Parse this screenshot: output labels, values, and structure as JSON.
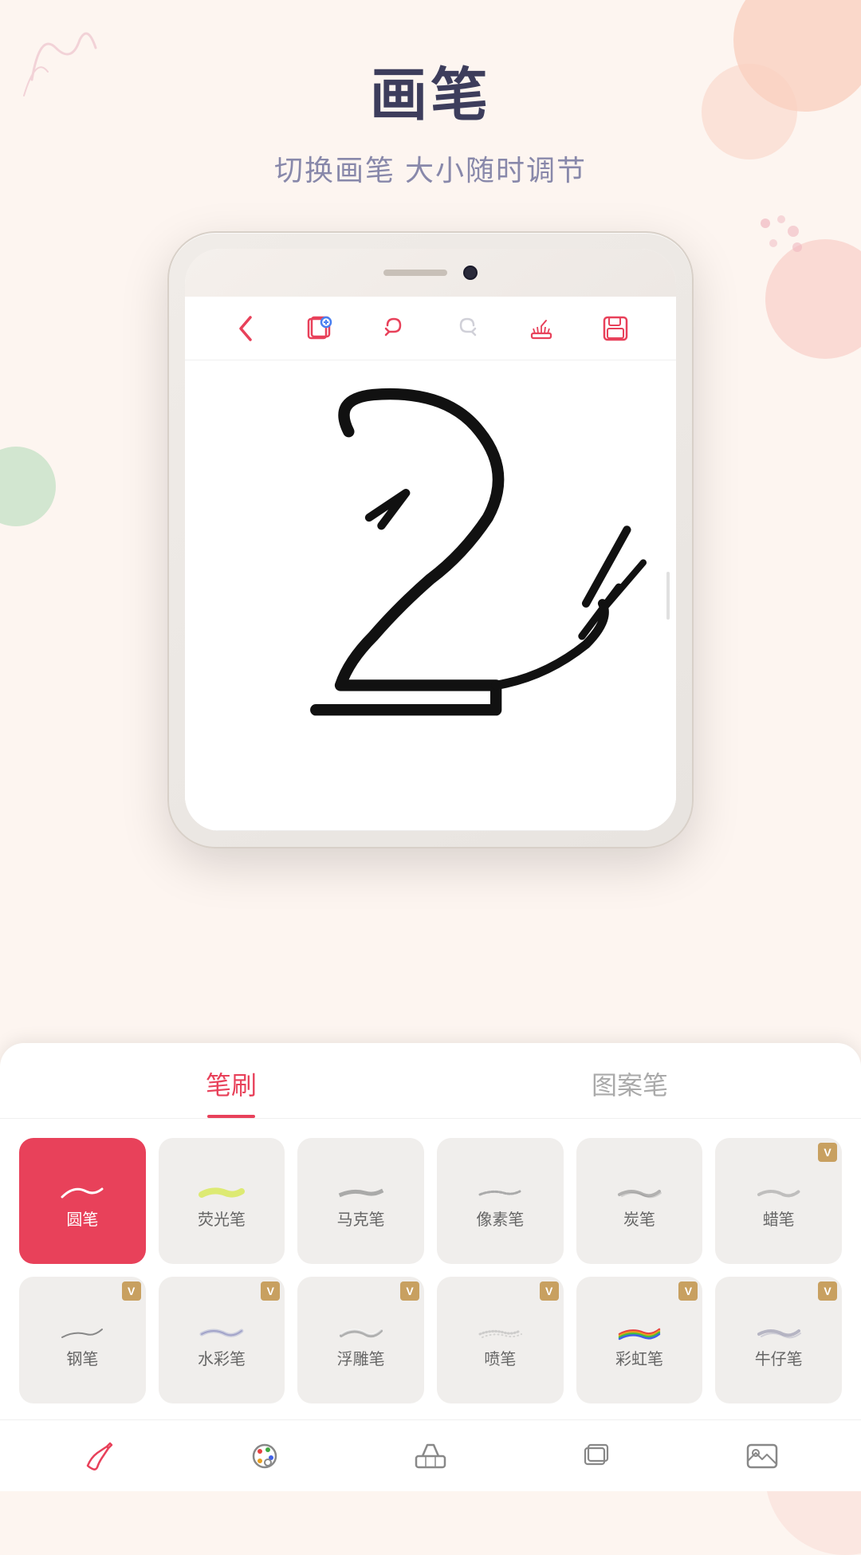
{
  "app": {
    "title": "画笔",
    "subtitle": "切换画笔  大小随时调节"
  },
  "toolbar": {
    "back_label": "‹",
    "layers_icon": "layers",
    "undo_icon": "undo",
    "redo_icon": "redo",
    "clear_icon": "clear",
    "save_icon": "save"
  },
  "brush_panel": {
    "tab_brush": "笔刷",
    "tab_pattern": "图案笔",
    "active_tab": "笔刷",
    "brushes": [
      {
        "id": "round",
        "name": "圆笔",
        "active": true,
        "vip": false
      },
      {
        "id": "highlight",
        "name": "荧光笔",
        "active": false,
        "vip": false
      },
      {
        "id": "marker",
        "name": "马克笔",
        "active": false,
        "vip": false
      },
      {
        "id": "pixel",
        "name": "像素笔",
        "active": false,
        "vip": false
      },
      {
        "id": "charcoal",
        "name": "炭笔",
        "active": false,
        "vip": false
      },
      {
        "id": "crayon",
        "name": "蜡笔",
        "active": false,
        "vip": true
      },
      {
        "id": "pen",
        "name": "钢笔",
        "active": false,
        "vip": true
      },
      {
        "id": "watercolor",
        "name": "水彩笔",
        "active": false,
        "vip": true
      },
      {
        "id": "relief",
        "name": "浮雕笔",
        "active": false,
        "vip": true
      },
      {
        "id": "spray",
        "name": "喷笔",
        "active": false,
        "vip": true
      },
      {
        "id": "rainbow",
        "name": "彩虹笔",
        "active": false,
        "vip": true
      },
      {
        "id": "denim",
        "name": "牛仔笔",
        "active": false,
        "vip": true
      }
    ]
  },
  "bottom_nav": {
    "items": [
      {
        "id": "brush",
        "label": "brush-nav-icon"
      },
      {
        "id": "palette",
        "label": "palette-nav-icon"
      },
      {
        "id": "eraser",
        "label": "eraser-nav-icon"
      },
      {
        "id": "layers",
        "label": "layers-nav-icon"
      },
      {
        "id": "gallery",
        "label": "gallery-nav-icon"
      }
    ]
  }
}
